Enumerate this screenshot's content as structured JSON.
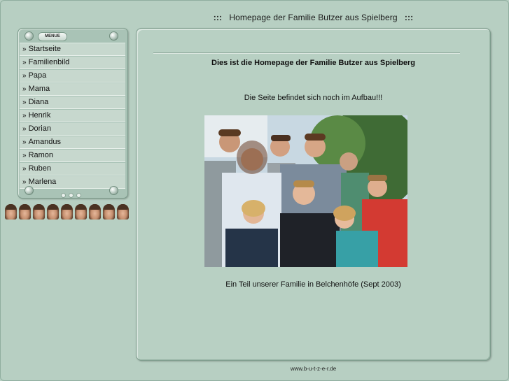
{
  "header": {
    "sep_left": ":::",
    "title": "Homepage der Familie Butzer aus Spielberg",
    "sep_right": ":::"
  },
  "menu": {
    "label": "MENUE",
    "arrow": "»",
    "items": [
      {
        "label": "Startseite"
      },
      {
        "label": "Familienbild"
      },
      {
        "label": "Papa"
      },
      {
        "label": "Mama"
      },
      {
        "label": "Diana"
      },
      {
        "label": "Henrik"
      },
      {
        "label": "Dorian"
      },
      {
        "label": "Amandus"
      },
      {
        "label": "Ramon"
      },
      {
        "label": "Ruben"
      },
      {
        "label": "Marlena"
      }
    ]
  },
  "main": {
    "heading": "Dies ist die Homepage der Familie Butzer aus Spielberg",
    "subtitle": "Die Seite befindet sich noch im Aufbau!!!",
    "caption": "Ein Teil unserer Familie in Belchenhöfe (Sept 2003)"
  },
  "footer": {
    "url": "www.b-u-t-z-e-r.de"
  },
  "colors": {
    "background": "#b7cfc2",
    "panel": "#b8d0c3",
    "menu_item": "#c7d8ce"
  }
}
